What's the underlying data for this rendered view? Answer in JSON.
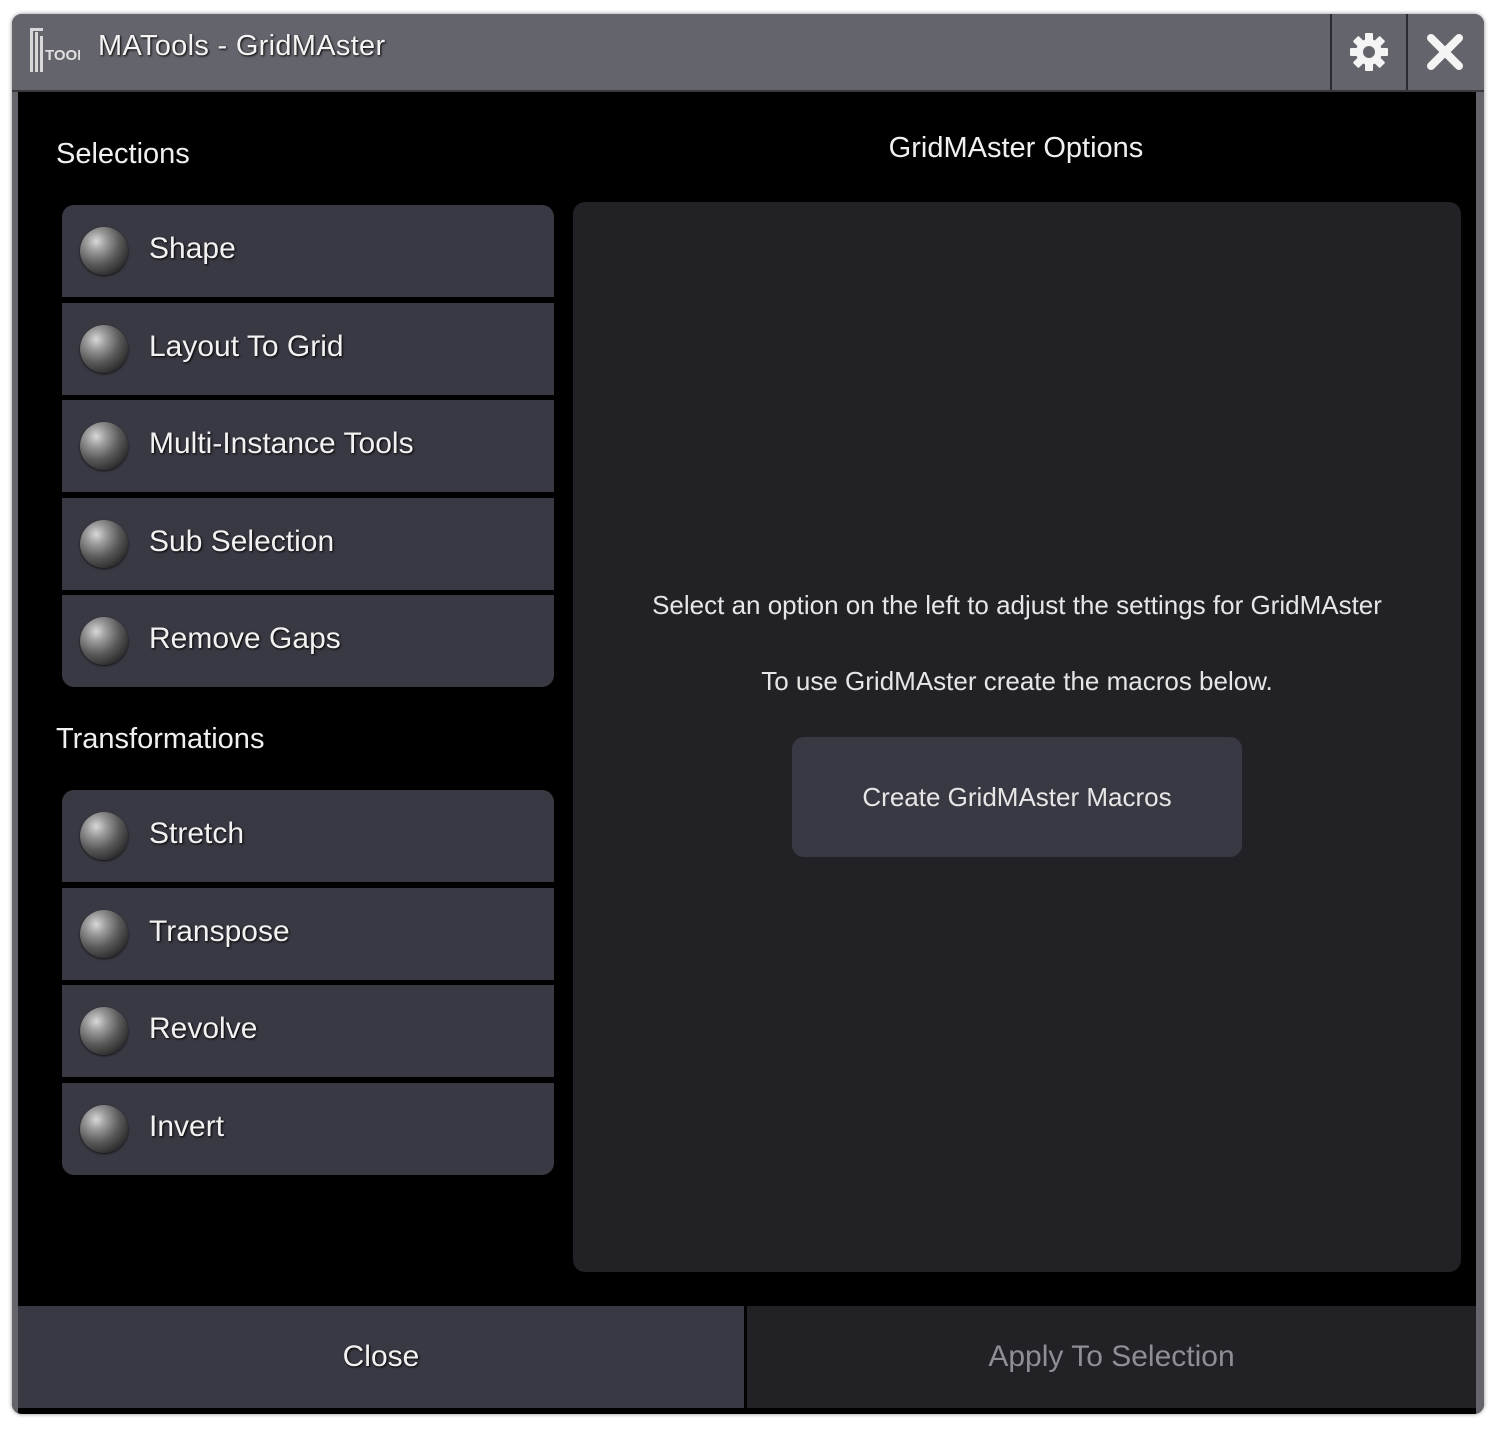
{
  "window": {
    "title": "MATools - GridMAster",
    "logo_text": "TOOLS"
  },
  "left": {
    "selections_label": "Selections",
    "selections": [
      {
        "label": "Shape"
      },
      {
        "label": "Layout To Grid"
      },
      {
        "label": "Multi-Instance Tools"
      },
      {
        "label": "Sub Selection"
      },
      {
        "label": "Remove Gaps"
      }
    ],
    "transformations_label": "Transformations",
    "transformations": [
      {
        "label": "Stretch"
      },
      {
        "label": "Transpose"
      },
      {
        "label": "Revolve"
      },
      {
        "label": "Invert"
      }
    ]
  },
  "options": {
    "title": "GridMAster Options",
    "info_line_1": "Select an option on the left to adjust the settings for GridMAster",
    "info_line_2": "To use GridMAster create the macros below.",
    "create_macros_label": "Create GridMAster Macros"
  },
  "footer": {
    "close_label": "Close",
    "apply_label": "Apply To Selection"
  },
  "icons": {
    "settings": "gear-icon",
    "close": "close-icon"
  },
  "colors": {
    "titlebar": "#64646c",
    "button": "#393943",
    "panel": "#212126",
    "background": "#000000",
    "disabled_text": "#8e8e94"
  }
}
